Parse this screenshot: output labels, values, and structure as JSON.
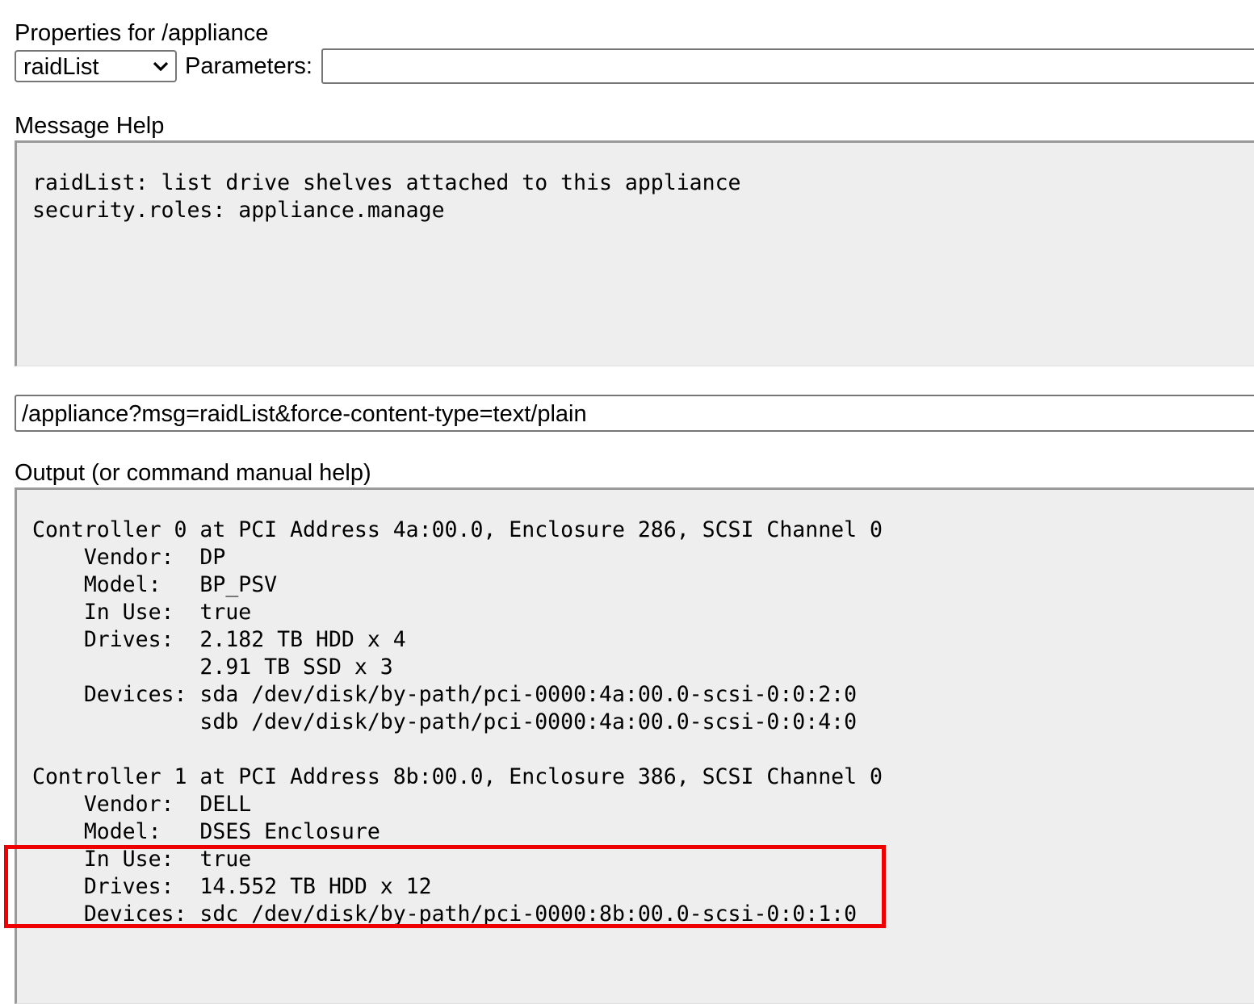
{
  "properties_title": "Properties for /appliance",
  "command_select": {
    "selected": "raidList"
  },
  "parameters": {
    "label": "Parameters:",
    "value": ""
  },
  "message_help": {
    "title": "Message Help",
    "text": "raidList: list drive shelves attached to this appliance\nsecurity.roles: appliance.manage"
  },
  "url": "/appliance?msg=raidList&force-content-type=text/plain",
  "output": {
    "title": "Output (or command manual help)",
    "text": "Controller 0 at PCI Address 4a:00.0, Enclosure 286, SCSI Channel 0\n    Vendor:  DP\n    Model:   BP_PSV\n    In Use:  true\n    Drives:  2.182 TB HDD x 4\n             2.91 TB SSD x 3\n    Devices: sda /dev/disk/by-path/pci-0000:4a:00.0-scsi-0:0:2:0\n             sdb /dev/disk/by-path/pci-0000:4a:00.0-scsi-0:0:4:0\n\nController 1 at PCI Address 8b:00.0, Enclosure 386, SCSI Channel 0\n    Vendor:  DELL\n    Model:   DSES Enclosure\n    In Use:  true\n    Drives:  14.552 TB HDD x 12\n    Devices: sdc /dev/disk/by-path/pci-0000:8b:00.0-scsi-0:0:1:0"
  },
  "highlight_color": "#ee0000"
}
